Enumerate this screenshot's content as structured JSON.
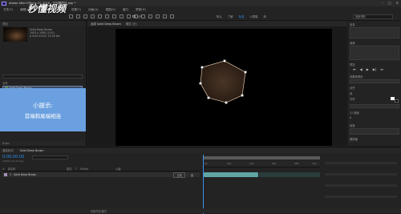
{
  "window": {
    "title": "Adobe After Effects CC 2018 - 无标题项目.aep *",
    "controls": [
      "–",
      "□",
      "✕"
    ]
  },
  "menu": {
    "items": [
      "文件(F)",
      "编辑(E)",
      "合成(C)",
      "图层(L)",
      "效果(T)",
      "动画(A)",
      "视图(V)",
      "窗口",
      "帮助(H)"
    ]
  },
  "toolbar": {
    "snap_label": "对齐",
    "workspaces": [
      "默认",
      "了解",
      "标准",
      "小屏幕",
      "库"
    ],
    "active_workspace": "标准",
    "search_placeholder": "搜索帮助"
  },
  "project": {
    "tab_label": "项目",
    "comp_name": "Solid Deep Brown",
    "comp_info": [
      "1920 x 1080 (1.00)",
      "Δ 0:00:10:00, 25.00 fps"
    ],
    "column_name": "名称",
    "item_name": "Solid Deep Brown",
    "bottom": [
      "8 bpc"
    ]
  },
  "tip": {
    "title": "小提示:",
    "text": "首端和尾端相连"
  },
  "viewer": {
    "tabs": [
      "合成 Solid Deep Brown",
      "图层 (无)"
    ],
    "active_tab": "合成 Solid Deep Brown",
    "controls": {
      "zoom": "50%",
      "timecode": "0:00:00:00",
      "resolution": "完整",
      "camera": "活动摄像机",
      "views": "1个...",
      "exposure": "+0.0"
    }
  },
  "right_panel": {
    "sections": [
      "信息",
      "音频",
      "预览",
      "效果和预设",
      "对齐",
      "库",
      "字符",
      "段落",
      "跟踪器"
    ],
    "preview_buttons": [
      "⏮",
      "◀",
      "▶",
      "▶|",
      "⏭"
    ],
    "swatch_colors": [
      "#ffffff",
      "#000000"
    ],
    "font_size": "12 像素",
    "tracking": "0"
  },
  "timeline": {
    "tabs": [
      "渲染队列",
      "Solid Deep Brown"
    ],
    "active_tab": "Solid Deep Brown",
    "timecode": "0:00:00:00",
    "timecode_sub": "00000 (25.00 fps)",
    "columns": [
      "#",
      "源名称",
      "模式",
      "T",
      "TrkMat",
      "父级"
    ],
    "layer": {
      "index": "1",
      "name": "Solid Deep Brown",
      "mode": "正常",
      "parent": "无"
    },
    "ruler_ticks": [
      "0s",
      "02s",
      "04s",
      "06s",
      "08s",
      "10s"
    ],
    "bottom": [
      "切换开关/模式"
    ]
  },
  "watermark": "秒懂视频",
  "colors": {
    "accent": "#2d8ceb",
    "clip": "#5fa6a4",
    "tip_bg": "#6aa0e0",
    "shape_stroke": "#ffe3c0"
  }
}
